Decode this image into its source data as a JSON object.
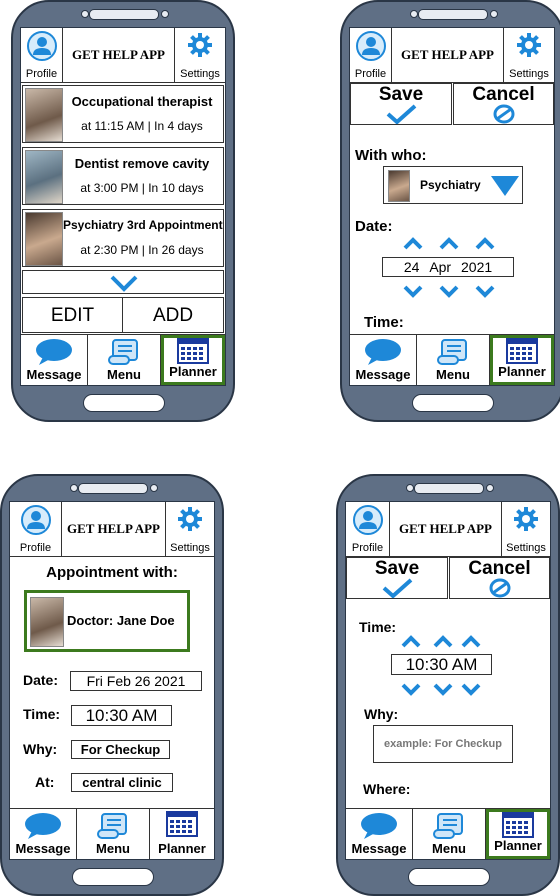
{
  "app": {
    "name": "GET HELP APP",
    "profile_label": "Profile",
    "settings_label": "Settings"
  },
  "nav": {
    "message": "Message",
    "menu": "Menu",
    "planner": "Planner"
  },
  "colors": {
    "accent": "#1e88d8",
    "frame": "#5f6f85",
    "active_border": "#3c7a1e"
  },
  "screen1": {
    "appointments": [
      {
        "title": "Occupational therapist",
        "when": "at 11:15 AM | In 4 days"
      },
      {
        "title": "Dentist remove cavity",
        "when": "at 3:00 PM | In 10 days"
      },
      {
        "title": "Psychiatry 3rd Appointment",
        "when": "at 2:30 PM | In 26 days"
      }
    ],
    "edit_label": "EDIT",
    "add_label": "ADD"
  },
  "screen2": {
    "save_label": "Save",
    "cancel_label": "Cancel",
    "with_who_label": "With who:",
    "with_who_value": "Psychiatry",
    "date_label": "Date:",
    "date_day": "24",
    "date_month": "Apr",
    "date_year": "2021",
    "time_label": "Time:"
  },
  "screen3": {
    "heading": "Appointment with:",
    "doctor": "Doctor: Jane Doe",
    "date_label": "Date:",
    "date_value": "Fri Feb 26 2021",
    "time_label": "Time:",
    "time_value": "10:30 AM",
    "why_label": "Why:",
    "why_value": "For Checkup",
    "at_label": "At:",
    "at_value": "central clinic"
  },
  "screen4": {
    "save_label": "Save",
    "cancel_label": "Cancel",
    "time_label": "Time:",
    "time_value": "10:30 AM",
    "why_label": "Why:",
    "why_placeholder": "example: For Checkup",
    "where_label": "Where:"
  }
}
